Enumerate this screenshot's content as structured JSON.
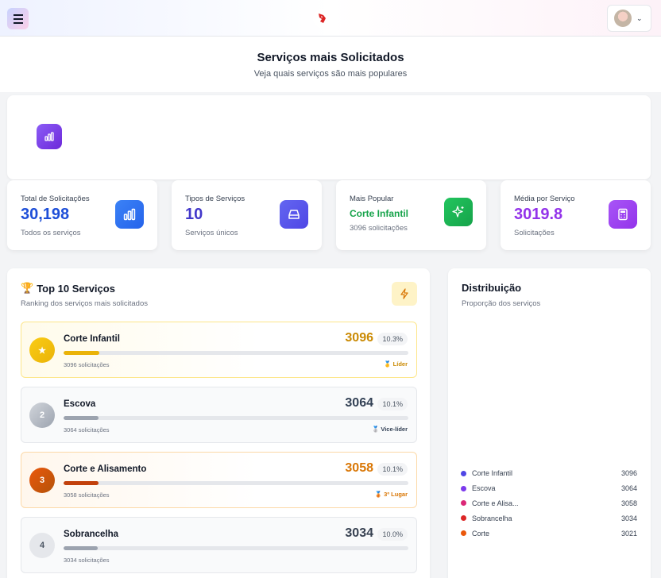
{
  "header": {
    "title": "Serviços mais Solicitados",
    "subtitle": "Veja quais serviços são mais populares"
  },
  "stats": [
    {
      "label": "Total de Solicitações",
      "value": "30,198",
      "sub": "Todos os serviços",
      "color": "#1d4ed8",
      "icon": "bar-chart-icon"
    },
    {
      "label": "Tipos de Serviços",
      "value": "10",
      "sub": "Serviços únicos",
      "color": "#4338ca",
      "icon": "inbox-icon"
    },
    {
      "label": "Mais Popular",
      "value": "Corte Infantil",
      "sub": "3096 solicitações",
      "color": "#16a34a",
      "icon": "sparkles-icon"
    },
    {
      "label": "Média por Serviço",
      "value": "3019.8",
      "sub": "Solicitações",
      "color": "#9333ea",
      "icon": "calculator-icon"
    }
  ],
  "top10": {
    "title": "Top 10 Serviços",
    "subtitle": "Ranking dos serviços mais solicitados",
    "items": [
      {
        "rank": "1",
        "name": "Corte Infantil",
        "count": "3096",
        "pct": "10.3%",
        "sub": "3096 solicitações",
        "tag": "🥇 Líder",
        "fill": 0.103,
        "color": "#ca8a04"
      },
      {
        "rank": "2",
        "name": "Escova",
        "count": "3064",
        "pct": "10.1%",
        "sub": "3064 solicitações",
        "tag": "🥈 Vice-líder",
        "fill": 0.101,
        "color": "#334155"
      },
      {
        "rank": "3",
        "name": "Corte e Alisamento",
        "count": "3058",
        "pct": "10.1%",
        "sub": "3058 solicitações",
        "tag": "🥉 3º Lugar",
        "fill": 0.101,
        "color": "#d97706"
      },
      {
        "rank": "4",
        "name": "Sobrancelha",
        "count": "3034",
        "pct": "10.0%",
        "sub": "3034 solicitações",
        "tag": "",
        "fill": 0.1,
        "color": "#374151"
      }
    ]
  },
  "distribution": {
    "title": "Distribuição",
    "subtitle": "Proporção dos serviços",
    "legend": [
      {
        "name": "Corte Infantil",
        "value": "3096",
        "color": "#4f46e5"
      },
      {
        "name": "Escova",
        "value": "3064",
        "color": "#7c3aed"
      },
      {
        "name": "Corte e Alisa...",
        "value": "3058",
        "color": "#db2777"
      },
      {
        "name": "Sobrancelha",
        "value": "3034",
        "color": "#dc2626"
      },
      {
        "name": "Corte",
        "value": "3021",
        "color": "#ea580c"
      }
    ]
  }
}
